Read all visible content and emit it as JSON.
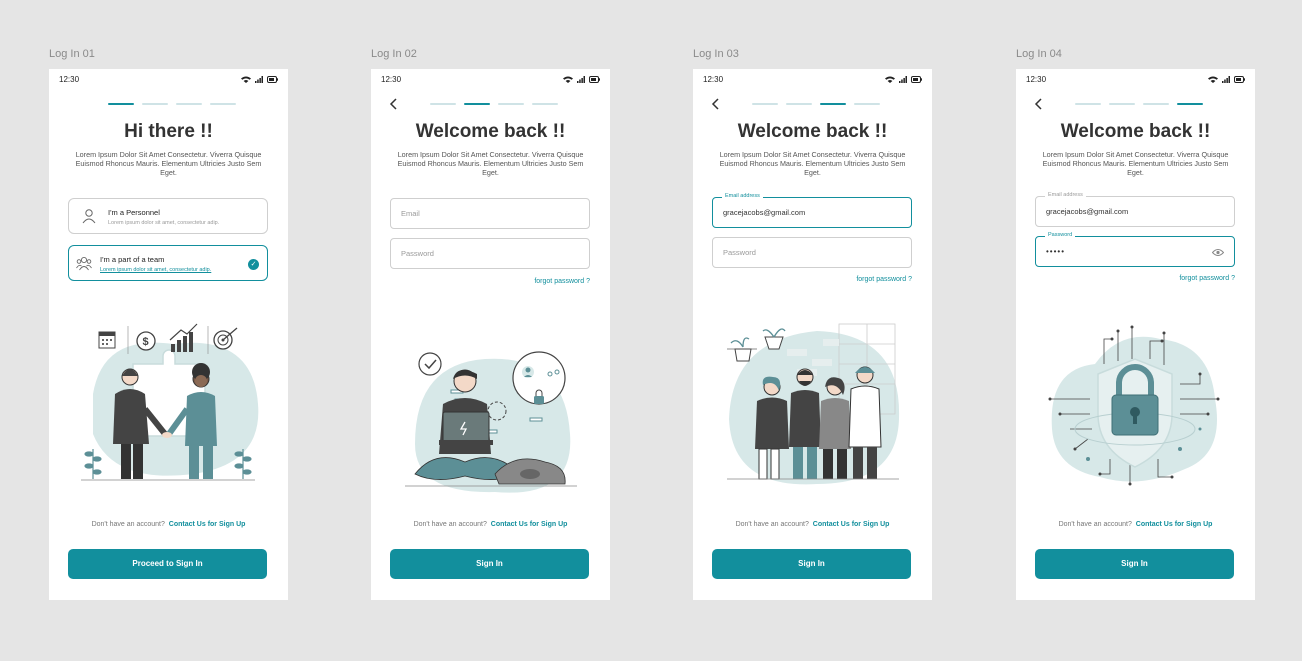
{
  "colors": {
    "accent": "#128f9d",
    "illustration_bg": "#d7e8e8",
    "text_dark": "#333333"
  },
  "frames": [
    {
      "label": "Log In 01",
      "status_time": "12:30",
      "title": "Hi there !!",
      "subtitle": "Lorem Ipsum Dolor Sit Amet Consectetur. Viverra Quisque Euismod Rhoncus Mauris. Elementum Ultricies Justo Sem Eget.",
      "roles": [
        {
          "title": "I'm a Personnel",
          "description": "Lorem ipsum dolor sit amet, consectetur adip.",
          "icon": "user-icon",
          "selected": false
        },
        {
          "title": "I'm a part of a team",
          "description": "Lorem ipsum dolor sit amet, consectetur adip.",
          "icon": "team-icon",
          "selected": true
        }
      ],
      "signup_prompt": "Don't have an account?",
      "signup_link": "Contact Us for Sign Up",
      "cta_label": "Proceed to Sign In"
    },
    {
      "label": "Log In 02",
      "status_time": "12:30",
      "title": "Welcome back !!",
      "subtitle": "Lorem Ipsum Dolor Sit Amet Consectetur. Viverra Quisque Euismod Rhoncus Mauris. Elementum Ultricies Justo Sem Eget.",
      "email_placeholder": "Email",
      "password_placeholder": "Password",
      "forgot_label": "forgot password ?",
      "signup_prompt": "Don't have an account?",
      "signup_link": "Contact Us for Sign Up",
      "cta_label": "Sign In"
    },
    {
      "label": "Log In 03",
      "status_time": "12:30",
      "title": "Welcome back !!",
      "subtitle": "Lorem Ipsum Dolor Sit Amet Consectetur. Viverra Quisque Euismod Rhoncus Mauris. Elementum Ultricies Justo Sem Eget.",
      "email_label": "Email address",
      "email_value": "gracejacobs@gmail.com",
      "password_placeholder": "Password",
      "forgot_label": "forgot password ?",
      "signup_prompt": "Don't have an account?",
      "signup_link": "Contact Us for Sign Up",
      "cta_label": "Sign In"
    },
    {
      "label": "Log In 04",
      "status_time": "12:30",
      "title": "Welcome back !!",
      "subtitle": "Lorem Ipsum Dolor Sit Amet Consectetur. Viverra Quisque Euismod Rhoncus Mauris. Elementum Ultricies Justo Sem Eget.",
      "email_label": "Email address",
      "email_value": "gracejacobs@gmail.com",
      "password_label": "Password",
      "password_value": "•••••",
      "forgot_label": "forgot password ?",
      "signup_prompt": "Don't have an account?",
      "signup_link": "Contact Us for Sign Up",
      "cta_label": "Sign In"
    }
  ]
}
